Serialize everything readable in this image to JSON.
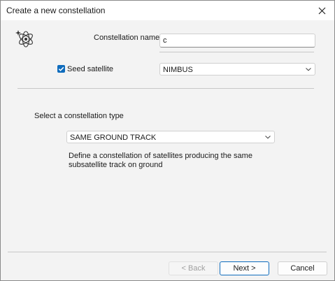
{
  "window": {
    "title": "Create a new constellation"
  },
  "form": {
    "name_label": "Constellation name",
    "name_value": "c",
    "seed_label": "Seed satellite",
    "seed_checked": true,
    "seed_value": "NIMBUS",
    "type_label": "Select a constellation type",
    "type_value": "SAME GROUND TRACK",
    "type_description": "Define a constellation of satellites producing the same subsatellite track on ground"
  },
  "buttons": {
    "back": "< Back",
    "next": "Next >",
    "cancel": "Cancel"
  },
  "icons": {
    "logo": "atom-constellation-icon",
    "close": "close-icon",
    "dropdown": "chevron-down-icon",
    "check": "checkmark-icon"
  },
  "colors": {
    "accent": "#0f6cbd"
  }
}
